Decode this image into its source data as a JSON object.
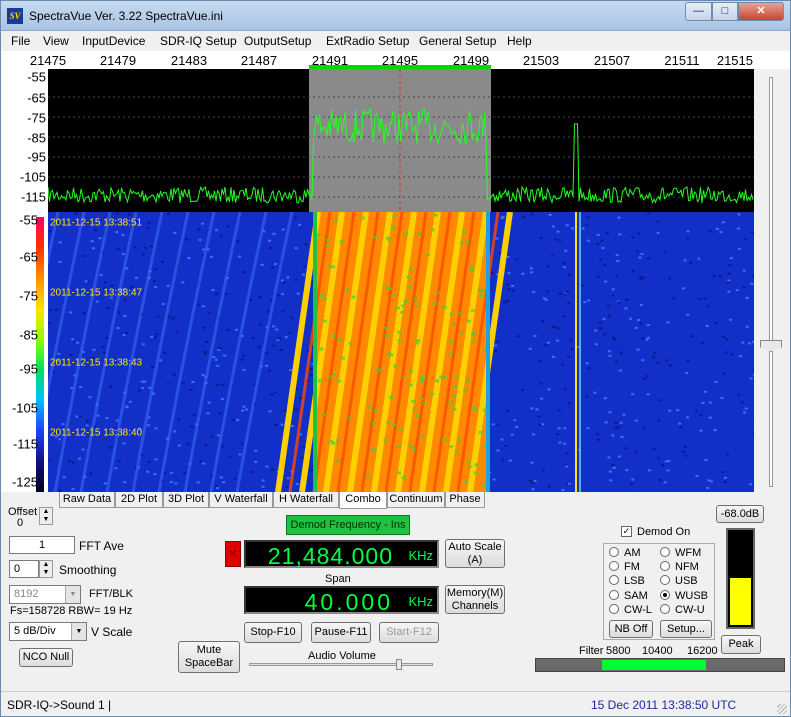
{
  "window": {
    "title": "SpectraVue Ver. 3.22 SpectraVue.ini",
    "icon_text": "SV",
    "controls": {
      "minimize": "—",
      "maximize": "□",
      "close": "✕"
    }
  },
  "menu": [
    "File",
    "View",
    "InputDevice",
    "SDR-IQ Setup",
    "OutputSetup",
    "ExtRadio Setup",
    "General Setup",
    "Help"
  ],
  "freq_ticks": [
    "21475",
    "21479",
    "21483",
    "21487",
    "21491",
    "21495",
    "21499",
    "21503",
    "21507",
    "21511",
    "21515"
  ],
  "spectrum": {
    "y_labels": [
      "-55",
      "-65",
      "-75",
      "-85",
      "-95",
      "-105",
      "-115"
    ],
    "trace_color": "#22ff22",
    "passband_color": "#8a8a8a",
    "center_marker_color": "#ff2020"
  },
  "waterfall": {
    "y_labels": [
      "-55",
      "-65",
      "-75",
      "-85",
      "-95",
      "-105",
      "-115",
      "-125"
    ],
    "timestamps": [
      "2011-12-15 13:38:51",
      "2011-12-15 13:38:47",
      "2011-12-15 13:38:43",
      "2011-12-15 13:38:40"
    ]
  },
  "tabs": [
    "Raw Data",
    "2D Plot",
    "3D Plot",
    "V Waterfall",
    "H Waterfall",
    "Combo",
    "Continuum",
    "Phase"
  ],
  "active_tab": "Combo",
  "controls": {
    "offset_label": "Offset",
    "offset_value": "0",
    "fft_ave_value": "1",
    "fft_ave_label": "FFT Ave",
    "smoothing_value": "0",
    "smoothing_label": "Smoothing",
    "fft_blk_value": "8192",
    "fft_blk_label": "FFT/BLK",
    "fs_info": "Fs=158728 RBW= 19 Hz",
    "vscale_value": "5 dB/Div",
    "vscale_label": "V Scale",
    "nco_null": "NCO Null",
    "mute": "Mute\nSpaceBar",
    "audio_volume": "Audio Volume"
  },
  "center": {
    "demod_frequency_label": "Demod Frequency - Ins",
    "red_x": "✕",
    "frequency_value": "21,484.000",
    "frequency_unit": "KHz",
    "auto_scale": "Auto Scale\n(A)",
    "span_label": "Span",
    "span_value": "40.000",
    "span_unit": "KHz",
    "memory_channels": "Memory(M)\nChannels",
    "stop": "Stop-F10",
    "pause": "Pause-F11",
    "start": "Start-F12"
  },
  "demod": {
    "demod_on_label": "Demod On",
    "demod_on_checked": "✓",
    "modes": [
      "AM",
      "WFM",
      "FM",
      "NFM",
      "LSB",
      "USB",
      "SAM",
      "WUSB",
      "CW-L",
      "CW-U"
    ],
    "selected_mode": "WUSB",
    "nb_off": "NB Off",
    "setup": "Setup..."
  },
  "meter": {
    "level": "-68.0dB",
    "peak": "Peak",
    "fill_fraction": 0.5
  },
  "filter": {
    "label": "Filter",
    "low": "5800",
    "mid": "10400",
    "high": "16200"
  },
  "status": {
    "left": "SDR-IQ->Sound 1  |",
    "right": "15 Dec 2011   13:38:50 UTC"
  }
}
